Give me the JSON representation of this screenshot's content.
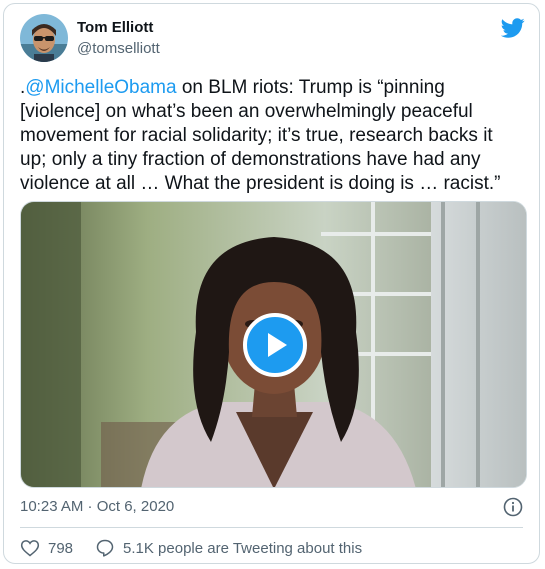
{
  "author": {
    "name": "Tom Elliott",
    "handle": "@tomselliott"
  },
  "tweet": {
    "prefix": ".",
    "mention": "@MichelleObama",
    "body": " on BLM riots: Trump is “pinning [violence] on what’s been an overwhelmingly peaceful movement for racial solidarity; it’s true, research backs it up; only a tiny fraction of demonstrations have had any violence at all … What the president is doing is … racist.”"
  },
  "meta": {
    "timestamp": "10:23 AM · Oct 6, 2020"
  },
  "actions": {
    "likes": "798",
    "conversation": "5.1K people are Tweeting about this"
  },
  "icons": {
    "brand": "twitter-bird-icon",
    "play": "play-icon",
    "info": "info-icon",
    "like": "heart-icon",
    "reply": "comment-icon"
  },
  "colors": {
    "accent": "#1d9bf0",
    "text": "#0f1419",
    "secondary": "#536471",
    "border": "#cfd9de"
  }
}
